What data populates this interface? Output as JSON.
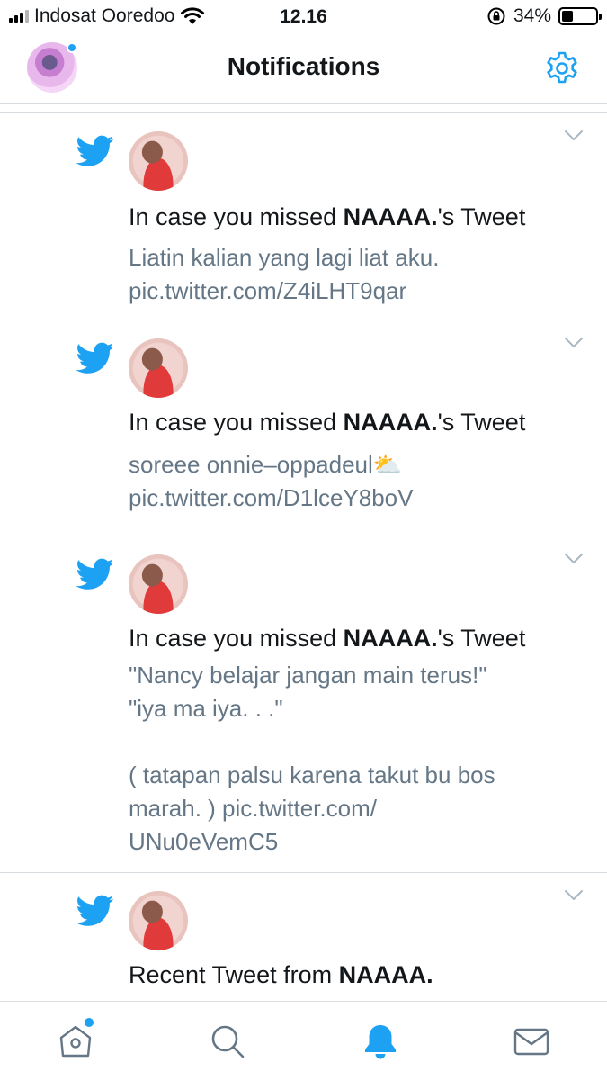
{
  "status_bar": {
    "carrier": "Indosat Ooredoo",
    "time": "12.16",
    "battery": "34%",
    "battery_level": 0.34
  },
  "header": {
    "title": "Notifications"
  },
  "notifications": [
    {
      "prefix": "In case you missed ",
      "user": "NAAAA.",
      "suffix": "'s Tweet",
      "body": "Liatin kalian yang lagi liat aku.\npic.twitter.com/Z4iLHT9qar"
    },
    {
      "prefix": "In case you missed ",
      "user": "NAAAA.",
      "suffix": "'s Tweet",
      "body": "soreee onnie–oppadeul⛅\npic.twitter.com/D1lceY8boV"
    },
    {
      "prefix": "In case you missed ",
      "user": "NAAAA.",
      "suffix": "'s Tweet",
      "body": "\"Nancy belajar jangan main terus!\"\n\"iya ma iya. . .\"\n\n( tatapan palsu karena takut bu bos\nmarah. ) pic.twitter.com/\nUNu0eVemC5"
    },
    {
      "prefix": "Recent Tweet from ",
      "user": "NAAAA.",
      "suffix": "",
      "body": ""
    }
  ],
  "icons": {
    "bird": "twitter-bird-icon",
    "gear": "gear-icon",
    "chevron": "chevron-down-icon",
    "home": "home-icon",
    "search": "search-icon",
    "bell": "bell-icon",
    "mail": "mail-icon"
  },
  "colors": {
    "accent": "#1da1f2",
    "secondary_text": "#657786",
    "divider": "#d8dde1"
  }
}
